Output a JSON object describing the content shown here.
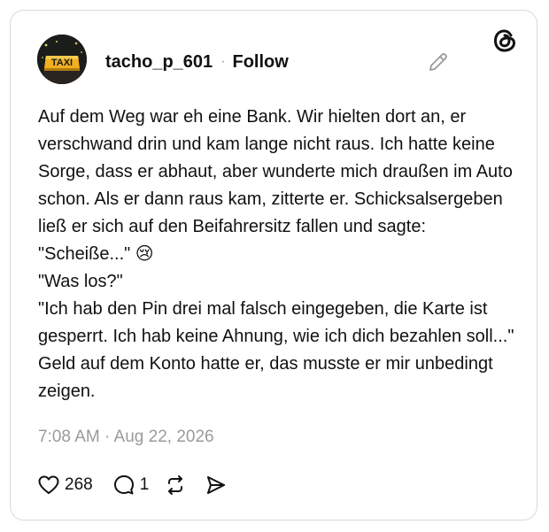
{
  "post": {
    "avatar_sign_text": "TAXI",
    "username": "tacho_p_601",
    "separator": "·",
    "follow_label": "Follow",
    "text": "Auf dem Weg war eh eine Bank. Wir hielten dort an, er verschwand drin und kam lange nicht raus. Ich hatte keine Sorge, dass er abhaut, aber wunderte mich draußen im Auto schon. Als er dann raus kam, zitterte er. Schicksalsergeben ließ er sich auf den Beifahrersitz fallen und sagte: \"Scheiße...\" 😢\n\"Was los?\"\n\"Ich hab den Pin drei mal falsch eingegeben, die Karte ist gesperrt. Ich hab keine Ahnung, wie ich dich bezahlen soll...\" Geld auf dem Konto hatte er, das musste er mir unbedingt zeigen.",
    "timestamp": "7:08 AM · Aug 22, 2026",
    "likes": "268",
    "replies": "1"
  },
  "icons": {
    "logo": "threads-logo-icon",
    "edit": "pencil-icon",
    "like": "heart-icon",
    "reply": "comment-icon",
    "repost": "repost-icon",
    "share": "send-icon"
  },
  "colors": {
    "text": "#111111",
    "muted": "#9a9a9a",
    "border": "#d9d9d9",
    "taxi_sign": "#f2b01e"
  }
}
